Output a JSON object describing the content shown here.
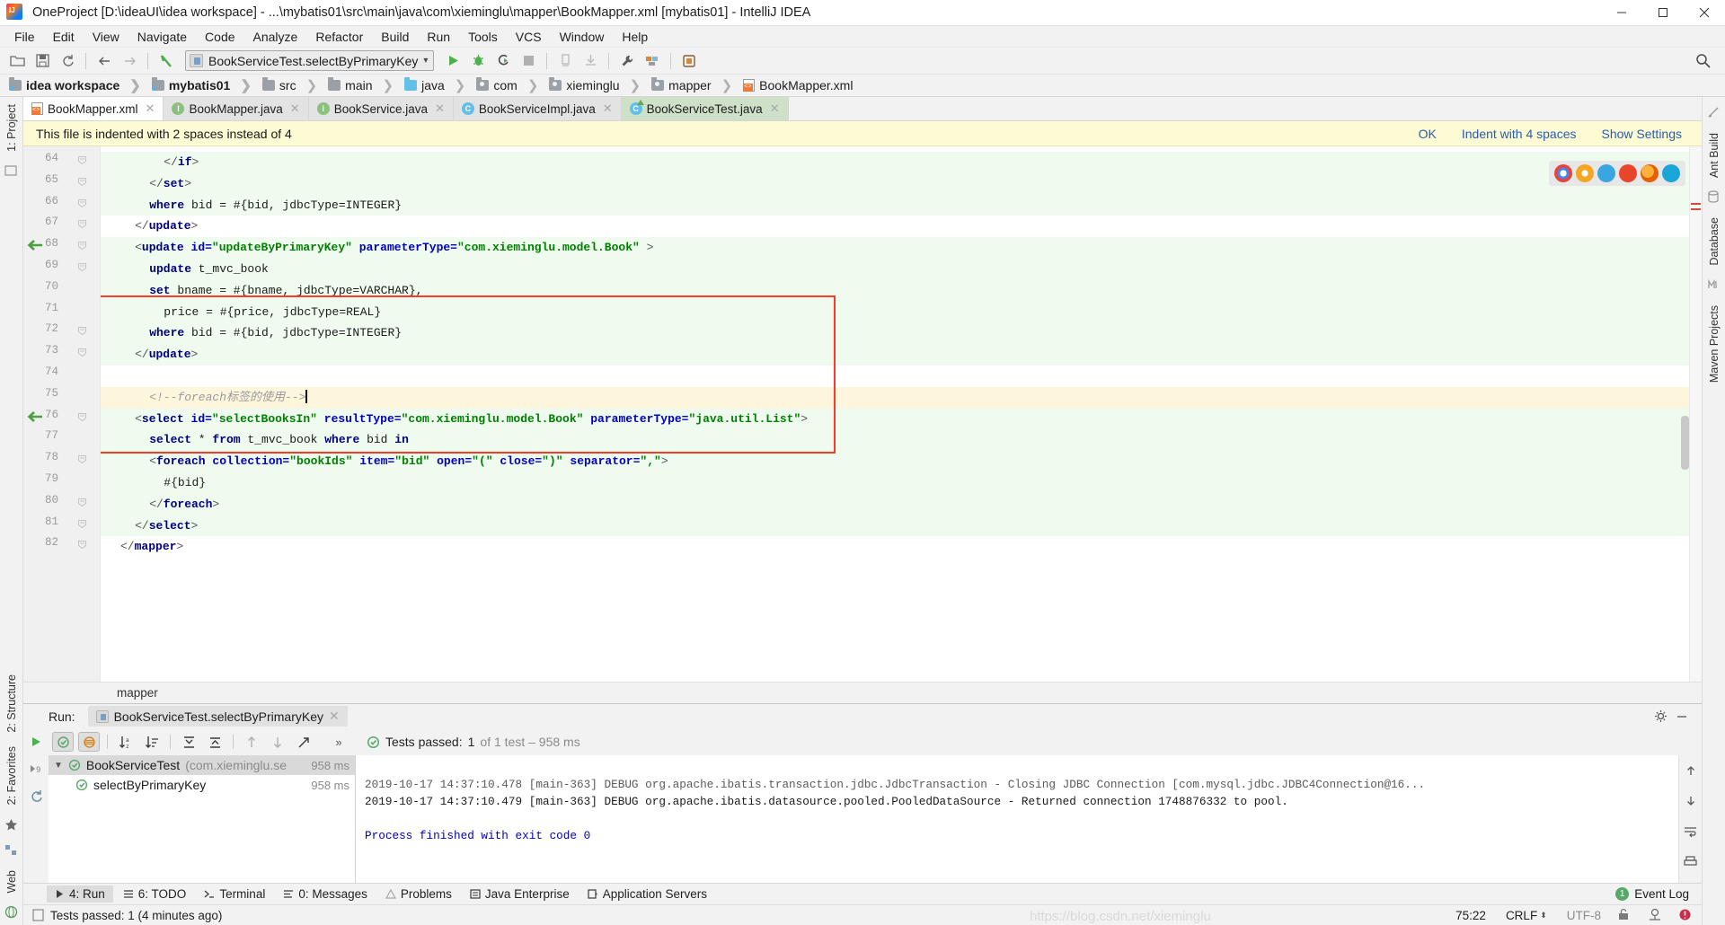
{
  "window": {
    "title": "OneProject [D:\\ideaUI\\idea workspace] - ...\\mybatis01\\src\\main\\java\\com\\xieminglu\\mapper\\BookMapper.xml [mybatis01] - IntelliJ IDEA",
    "app_icon": "intellij-idea-icon",
    "minimize": "minimize-icon",
    "maximize": "maximize-icon",
    "close": "close-icon"
  },
  "menubar": {
    "items": [
      {
        "label": "File"
      },
      {
        "label": "Edit"
      },
      {
        "label": "View"
      },
      {
        "label": "Navigate"
      },
      {
        "label": "Code"
      },
      {
        "label": "Analyze"
      },
      {
        "label": "Refactor"
      },
      {
        "label": "Build"
      },
      {
        "label": "Run"
      },
      {
        "label": "Tools"
      },
      {
        "label": "VCS"
      },
      {
        "label": "Window"
      },
      {
        "label": "Help"
      }
    ]
  },
  "toolbar": {
    "icons": [
      "open-folder-icon",
      "save-icon",
      "sync-icon",
      "back-arrow-icon",
      "forward-arrow-icon",
      "compile-icon"
    ],
    "run_config": "BookServiceTest.selectByPrimaryKey",
    "run_icons": [
      "run-icon",
      "debug-icon",
      "run-with-coverage-icon",
      "stop-icon",
      "inspect-icon",
      "update-app-icon",
      "settings-wrench-icon",
      "project-structure-icon",
      "sdk-manager-icon"
    ],
    "search_icon": "search-everywhere-icon"
  },
  "breadcrumb": {
    "items": [
      {
        "label": "idea workspace",
        "icon": "project-folder-icon"
      },
      {
        "label": "mybatis01",
        "icon": "module-folder-icon"
      },
      {
        "label": "src",
        "icon": "folder-icon"
      },
      {
        "label": "main",
        "icon": "folder-icon"
      },
      {
        "label": "java",
        "icon": "source-folder-icon"
      },
      {
        "label": "com",
        "icon": "package-icon"
      },
      {
        "label": "xieminglu",
        "icon": "package-icon"
      },
      {
        "label": "mapper",
        "icon": "package-icon"
      },
      {
        "label": "BookMapper.xml",
        "icon": "xml-file-icon"
      }
    ]
  },
  "editor_tabs": [
    {
      "label": "BookMapper.xml",
      "icon": "xml-file-icon",
      "state": "active"
    },
    {
      "label": "BookMapper.java",
      "icon": "interface-icon",
      "state": "normal"
    },
    {
      "label": "BookService.java",
      "icon": "interface-icon",
      "state": "normal"
    },
    {
      "label": "BookServiceImpl.java",
      "icon": "class-icon",
      "state": "normal"
    },
    {
      "label": "BookServiceTest.java",
      "icon": "test-class-icon",
      "state": "selected"
    }
  ],
  "notification": {
    "message": "This file is indented with 2 spaces instead of 4",
    "actions": [
      "OK",
      "Indent with 4 spaces",
      "Show Settings"
    ]
  },
  "left_strip": {
    "items": [
      "1: Project",
      "2: Structure",
      "2: Favorites",
      "Web"
    ]
  },
  "right_strip": {
    "items": [
      "Ant Build",
      "Database",
      "Maven Projects"
    ]
  },
  "code": {
    "first_line": 64,
    "lines": [
      {
        "n": 64,
        "indent": 6,
        "bg": "green",
        "fold": true,
        "tokens": [
          {
            "t": "punct",
            "v": "</"
          },
          {
            "t": "tagname",
            "v": "if"
          },
          {
            "t": "punct",
            "v": ">"
          }
        ]
      },
      {
        "n": 65,
        "indent": 4,
        "bg": "green",
        "fold": true,
        "tokens": [
          {
            "t": "punct",
            "v": "</"
          },
          {
            "t": "tagname",
            "v": "set"
          },
          {
            "t": "punct",
            "v": ">"
          }
        ]
      },
      {
        "n": 66,
        "indent": 4,
        "bg": "green",
        "fold": true,
        "tokens": [
          {
            "t": "tagname",
            "v": "where"
          },
          {
            "t": "plain",
            "v": " bid = #{bid, jdbcType=INTEGER}"
          }
        ]
      },
      {
        "n": 67,
        "indent": 2,
        "bg": "none",
        "fold": true,
        "tokens": [
          {
            "t": "punct",
            "v": "</"
          },
          {
            "t": "tagname",
            "v": "update"
          },
          {
            "t": "punct",
            "v": ">"
          }
        ]
      },
      {
        "n": 68,
        "indent": 2,
        "bg": "green",
        "fold": true,
        "arrow": true,
        "tokens": [
          {
            "t": "punct",
            "v": "<"
          },
          {
            "t": "tagname",
            "v": "update "
          },
          {
            "t": "attr",
            "v": "id="
          },
          {
            "t": "attrval",
            "v": "\"updateByPrimaryKey\""
          },
          {
            "t": "plain",
            "v": " "
          },
          {
            "t": "attr",
            "v": "parameterType="
          },
          {
            "t": "attrval",
            "v": "\"com.xieminglu.model.Book\""
          },
          {
            "t": "punct",
            "v": " >"
          }
        ]
      },
      {
        "n": 69,
        "indent": 4,
        "bg": "green",
        "fold": true,
        "tokens": [
          {
            "t": "tagname",
            "v": "update"
          },
          {
            "t": "plain",
            "v": " t_mvc_book"
          }
        ]
      },
      {
        "n": 70,
        "indent": 4,
        "bg": "green",
        "fold": false,
        "tokens": [
          {
            "t": "tagname",
            "v": "set"
          },
          {
            "t": "plain",
            "v": " bname = #{bname, jdbcType=VARCHAR},"
          }
        ]
      },
      {
        "n": 71,
        "indent": 6,
        "bg": "green",
        "fold": false,
        "tokens": [
          {
            "t": "plain",
            "v": "price = #{price, jdbcType=REAL}"
          }
        ]
      },
      {
        "n": 72,
        "indent": 4,
        "bg": "green",
        "fold": true,
        "tokens": [
          {
            "t": "tagname",
            "v": "where"
          },
          {
            "t": "plain",
            "v": " bid = #{bid, jdbcType=INTEGER}"
          }
        ]
      },
      {
        "n": 73,
        "indent": 2,
        "bg": "green",
        "fold": true,
        "tokens": [
          {
            "t": "punct",
            "v": "</"
          },
          {
            "t": "tagname",
            "v": "update"
          },
          {
            "t": "punct",
            "v": ">"
          }
        ]
      },
      {
        "n": 74,
        "indent": 0,
        "bg": "none",
        "fold": false,
        "tokens": []
      },
      {
        "n": 75,
        "indent": 4,
        "bg": "cur",
        "fold": false,
        "caret": true,
        "tokens": [
          {
            "t": "comment",
            "v": "<!--foreach标签的使用-->"
          }
        ]
      },
      {
        "n": 76,
        "indent": 2,
        "bg": "green",
        "fold": true,
        "arrow": true,
        "tokens": [
          {
            "t": "punct",
            "v": "<"
          },
          {
            "t": "tagname",
            "v": "select "
          },
          {
            "t": "attr",
            "v": "id="
          },
          {
            "t": "attrval",
            "v": "\"selectBooksIn\""
          },
          {
            "t": "plain",
            "v": " "
          },
          {
            "t": "attr",
            "v": "resultType="
          },
          {
            "t": "attrval",
            "v": "\"com.xieminglu.model.Book\""
          },
          {
            "t": "plain",
            "v": " "
          },
          {
            "t": "attr",
            "v": "parameterType="
          },
          {
            "t": "attrval",
            "v": "\"java.util.List\""
          },
          {
            "t": "punct",
            "v": ">"
          }
        ]
      },
      {
        "n": 77,
        "indent": 4,
        "bg": "green",
        "fold": false,
        "tokens": [
          {
            "t": "tagname",
            "v": "select"
          },
          {
            "t": "plain",
            "v": " * "
          },
          {
            "t": "tagname",
            "v": "from"
          },
          {
            "t": "plain",
            "v": " t_mvc_book "
          },
          {
            "t": "tagname",
            "v": "where"
          },
          {
            "t": "plain",
            "v": " bid "
          },
          {
            "t": "tagname",
            "v": "in"
          }
        ]
      },
      {
        "n": 78,
        "indent": 4,
        "bg": "green",
        "fold": true,
        "tokens": [
          {
            "t": "punct",
            "v": "<"
          },
          {
            "t": "tagname",
            "v": "foreach "
          },
          {
            "t": "attr",
            "v": "collection="
          },
          {
            "t": "attrval",
            "v": "\"bookIds\""
          },
          {
            "t": "plain",
            "v": " "
          },
          {
            "t": "attr",
            "v": "item="
          },
          {
            "t": "attrval",
            "v": "\"bid\""
          },
          {
            "t": "plain",
            "v": " "
          },
          {
            "t": "attr",
            "v": "open="
          },
          {
            "t": "attrval",
            "v": "\"(\""
          },
          {
            "t": "plain",
            "v": " "
          },
          {
            "t": "attr",
            "v": "close="
          },
          {
            "t": "attrval",
            "v": "\")\""
          },
          {
            "t": "plain",
            "v": " "
          },
          {
            "t": "attr",
            "v": "separator="
          },
          {
            "t": "attrval",
            "v": "\",\""
          },
          {
            "t": "punct",
            "v": ">"
          }
        ]
      },
      {
        "n": 79,
        "indent": 6,
        "bg": "green",
        "fold": false,
        "tokens": [
          {
            "t": "plain",
            "v": "#{bid}"
          }
        ]
      },
      {
        "n": 80,
        "indent": 4,
        "bg": "green",
        "fold": true,
        "tokens": [
          {
            "t": "punct",
            "v": "</"
          },
          {
            "t": "tagname",
            "v": "foreach"
          },
          {
            "t": "punct",
            "v": ">"
          }
        ]
      },
      {
        "n": 81,
        "indent": 2,
        "bg": "green",
        "fold": true,
        "tokens": [
          {
            "t": "punct",
            "v": "</"
          },
          {
            "t": "tagname",
            "v": "select"
          },
          {
            "t": "punct",
            "v": ">"
          }
        ]
      },
      {
        "n": 82,
        "indent": 0,
        "bg": "none",
        "fold": true,
        "tokens": [
          {
            "t": "punct",
            "v": "</"
          },
          {
            "t": "tagname",
            "v": "mapper"
          },
          {
            "t": "punct",
            "v": ">"
          }
        ]
      }
    ],
    "browser_icons": [
      "chrome-icon",
      "safari-icon",
      "ie-icon",
      "opera-icon",
      "firefox-icon",
      "edge-icon"
    ],
    "breadcrumb_footer": "mapper"
  },
  "run_panel": {
    "label": "Run:",
    "tab": "BookServiceTest.selectByPrimaryKey",
    "toolbar_icons": [
      "rerun-icon",
      "rerun-failed-icon",
      "show-passed-icon",
      "show-ignored-icon",
      "sort-alphabetically-icon",
      "sort-by-duration-icon",
      "expand-all-icon",
      "collapse-all-icon",
      "prev-test-icon",
      "next-test-icon",
      "export-icon",
      "more-icon"
    ],
    "status": {
      "prefix": "Tests passed:",
      "count": "1",
      "suffix": "of 1 test – 958 ms"
    },
    "tree": [
      {
        "label": "BookServiceTest",
        "detail": "(com.xieminglu.se",
        "time": "958 ms",
        "level": 0,
        "selected": true,
        "icon": "test-passed-icon"
      },
      {
        "label": "selectByPrimaryKey",
        "detail": "",
        "time": "958 ms",
        "level": 1,
        "selected": false,
        "icon": "test-passed-icon"
      }
    ],
    "console": [
      {
        "text": "2019-10-17 14:37:10.478 [main-363] DEBUG org.apache.ibatis.transaction.jdbc.JdbcTransaction - Closing JDBC Connection [com.mysql.jdbc.JDBC4Connection@16...",
        "style": "clip"
      },
      {
        "text": "2019-10-17 14:37:10.479 [main-363] DEBUG org.apache.ibatis.datasource.pooled.PooledDataSource - Returned connection 1748876332 to pool.",
        "style": "normal"
      },
      {
        "text": "",
        "style": "normal"
      },
      {
        "text": "Process finished with exit code 0",
        "style": "blue"
      }
    ]
  },
  "toolwindow_bar": {
    "tabs": [
      {
        "label": "4: Run",
        "icon": "run-icon",
        "active": true
      },
      {
        "label": "6: TODO",
        "icon": "todo-icon",
        "active": false
      },
      {
        "label": "Terminal",
        "icon": "terminal-icon",
        "active": false
      },
      {
        "label": "0: Messages",
        "icon": "messages-icon",
        "active": false
      },
      {
        "label": "Problems",
        "icon": "problems-icon",
        "active": false
      },
      {
        "label": "Java Enterprise",
        "icon": "java-enterprise-icon",
        "active": false
      },
      {
        "label": "Application Servers",
        "icon": "app-servers-icon",
        "active": false
      }
    ],
    "event_log": {
      "label": "Event Log",
      "badge": "1"
    }
  },
  "statusbar": {
    "message": "Tests passed: 1 (4 minutes ago)",
    "caret_position": "75:22",
    "line_separator": "CRLF",
    "encoding": "UTF-8",
    "icons": [
      "lock-icon",
      "git-branch-icon",
      "notification-icon"
    ],
    "watermark": "https://blog.csdn.net/xieminglu"
  }
}
